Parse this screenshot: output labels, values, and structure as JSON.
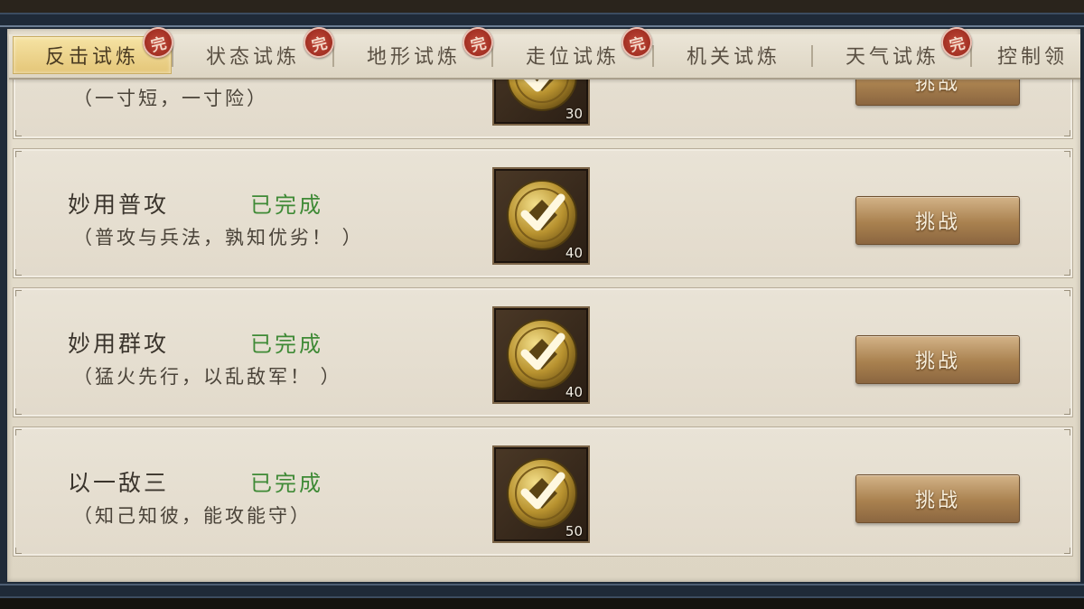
{
  "tabs": [
    {
      "label": "反击试炼",
      "active": true,
      "completed": true
    },
    {
      "label": "状态试炼",
      "active": false,
      "completed": true
    },
    {
      "label": "地形试炼",
      "active": false,
      "completed": true
    },
    {
      "label": "走位试炼",
      "active": false,
      "completed": true
    },
    {
      "label": "机关试炼",
      "active": false,
      "completed": false
    },
    {
      "label": "天气试炼",
      "active": false,
      "completed": true
    },
    {
      "label": "控制领",
      "active": false,
      "completed": false
    }
  ],
  "stamp_char": "完",
  "trials": [
    {
      "name": "",
      "status": "",
      "desc": "（一寸短，一寸险）",
      "reward_count": "30",
      "button": "挑战"
    },
    {
      "name": "妙用普攻",
      "status": "已完成",
      "desc": "（普攻与兵法，孰知优劣！ ）",
      "reward_count": "40",
      "button": "挑战"
    },
    {
      "name": "妙用群攻",
      "status": "已完成",
      "desc": "（猛火先行，以乱敌军！ ）",
      "reward_count": "40",
      "button": "挑战"
    },
    {
      "name": "以一敌三",
      "status": "已完成",
      "desc": "（知己知彼，能攻能守）",
      "reward_count": "50",
      "button": "挑战"
    }
  ],
  "colors": {
    "status_green": "#3f8a36",
    "active_tab": "#e9cc80",
    "stamp_red": "#a8301f",
    "frame_navy": "#1f2a38"
  },
  "icons": {
    "reward": "gold-coin-checkmark-icon",
    "stamp": "completed-seal-icon"
  }
}
